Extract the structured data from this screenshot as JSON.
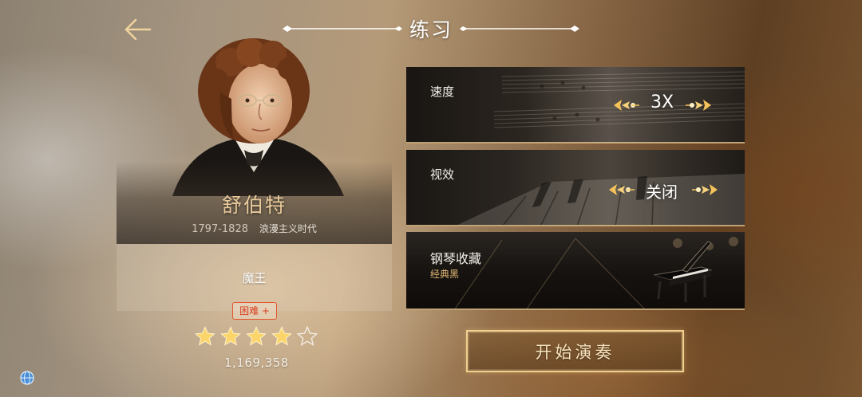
{
  "header": {
    "title": "练习",
    "back_icon": "arrow-left-icon"
  },
  "composer": {
    "name": "舒伯特",
    "years": "1797-1828",
    "era": "浪漫主义时代"
  },
  "song": {
    "title": "魔王",
    "difficulty": "困难 +",
    "rating": 4,
    "max_rating": 5,
    "play_count": "1,169,358"
  },
  "settings": {
    "speed": {
      "label": "速度",
      "value": "3X"
    },
    "visual": {
      "label": "视效",
      "value": "关闭"
    },
    "piano": {
      "label": "钢琴收藏",
      "sub": "经典黑"
    }
  },
  "start_button": {
    "label": "开始演奏"
  },
  "colors": {
    "gold": "#e8c99a",
    "badge_red": "#d8401e",
    "star_gold": "#fbd46a",
    "button_border": "#f2d08e"
  },
  "icons": {
    "globe": "globe-icon",
    "star": "star-icon",
    "ornament": "ornament-arrow-icon"
  }
}
